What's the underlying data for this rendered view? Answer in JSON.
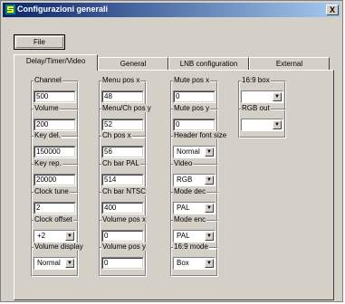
{
  "window": {
    "title": "Configurazioni generali",
    "close_label": "X"
  },
  "file_button": "File",
  "tabs": [
    "Delay/Timer/Video",
    "General",
    "LNB configuration",
    "External"
  ],
  "fields": [
    {
      "label": "Channel",
      "value": "500",
      "type": "text"
    },
    {
      "label": "Volume",
      "value": "200",
      "type": "text"
    },
    {
      "label": "Key del.",
      "value": "150000",
      "type": "text"
    },
    {
      "label": "Key rep.",
      "value": "20000",
      "type": "text"
    },
    {
      "label": "Clock tune",
      "value": "2",
      "type": "text"
    },
    {
      "label": "Clock offset",
      "value": "+2",
      "type": "select"
    },
    {
      "label": "Volume display",
      "value": "Normal",
      "type": "select"
    },
    {
      "label": "Menu pos x",
      "value": "48",
      "type": "text"
    },
    {
      "label": "Menu/Ch pos y",
      "value": "52",
      "type": "text"
    },
    {
      "label": "Ch pos x",
      "value": "56",
      "type": "text"
    },
    {
      "label": "Ch bar PAL",
      "value": "514",
      "type": "text"
    },
    {
      "label": "Ch bar NTSC",
      "value": "400",
      "type": "text"
    },
    {
      "label": "Volume pos x",
      "value": "0",
      "type": "text"
    },
    {
      "label": "Volume pos y",
      "value": "0",
      "type": "text"
    },
    {
      "label": "Mute pos x",
      "value": "0",
      "type": "text"
    },
    {
      "label": "Mute pos y",
      "value": "0",
      "type": "text"
    },
    {
      "label": "Header font size",
      "value": "Normal",
      "type": "select"
    },
    {
      "label": "Video",
      "value": "RGB",
      "type": "select"
    },
    {
      "label": "Mode dec",
      "value": "PAL",
      "type": "select"
    },
    {
      "label": "Mode enc",
      "value": "PAL",
      "type": "select"
    },
    {
      "label": "16:9 mode",
      "value": "Box",
      "type": "select"
    },
    {
      "label": "16:9 box",
      "value": "",
      "type": "select"
    },
    {
      "label": "RGB out",
      "value": "",
      "type": "select"
    }
  ]
}
